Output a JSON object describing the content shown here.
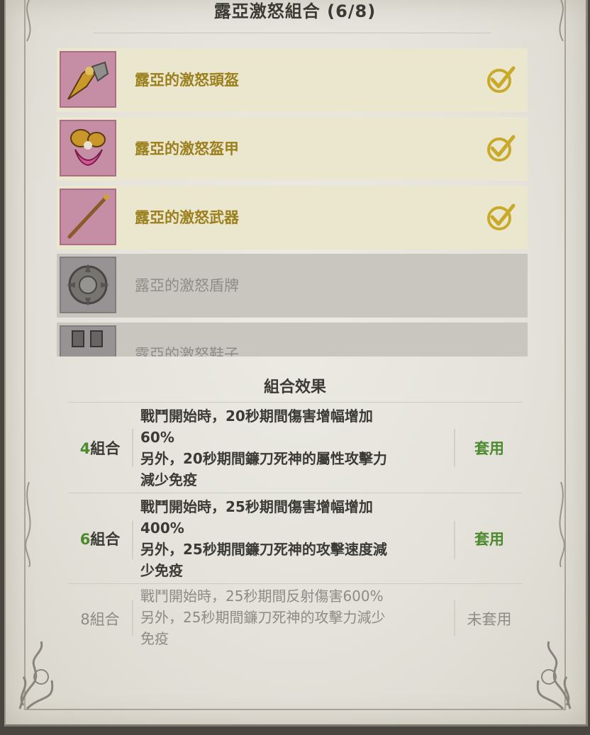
{
  "title": "露亞激怒組合 (6/8)",
  "items": [
    {
      "name": "露亞的激怒頭盔",
      "icon": "helmet-icon",
      "equipped": true
    },
    {
      "name": "露亞的激怒盔甲",
      "icon": "armor-icon",
      "equipped": true
    },
    {
      "name": "露亞的激怒武器",
      "icon": "weapon-icon",
      "equipped": true
    },
    {
      "name": "露亞的激怒盾牌",
      "icon": "shield-icon",
      "equipped": false
    },
    {
      "name": "露亞的激怒鞋子",
      "icon": "shoes-icon",
      "equipped": false
    }
  ],
  "effects_title": "組合效果",
  "effects": [
    {
      "level_num": "4",
      "level_suffix": "組合",
      "description": "戰鬥開始時，20秒期間傷害增幅增加\n60%\n另外，20秒期間鐮刀死神的屬性攻擊力\n減少免疫",
      "status": "套用",
      "applied": true
    },
    {
      "level_num": "6",
      "level_suffix": "組合",
      "description": "戰鬥開始時，25秒期間傷害增幅增加\n400%\n另外，25秒期間鐮刀死神的攻擊速度減\n少免疫",
      "status": "套用",
      "applied": true
    },
    {
      "level_num": "8",
      "level_suffix": "組合",
      "description": "戰鬥開始時，25秒期間反射傷害600%\n另外，25秒期間鐮刀死神的攻擊力減少\n免疫",
      "status": "未套用",
      "applied": false
    }
  ],
  "colors": {
    "applied": "#4d8a2e",
    "item_name": "#9a7f1c",
    "check": "#c9a92a",
    "dim": "#8e8b85"
  }
}
